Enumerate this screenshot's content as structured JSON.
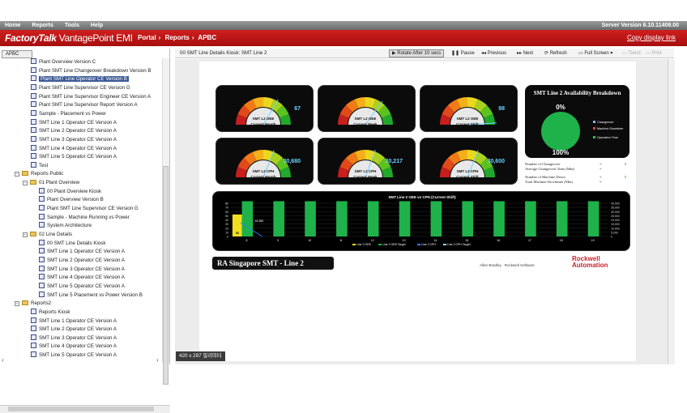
{
  "menu": {
    "items": [
      "Home",
      "Reports",
      "Tools",
      "Help"
    ],
    "server_version": "Server Version 6.10.11409.00"
  },
  "header": {
    "brand_bold": "FactoryTalk",
    "brand_rest": " VantagePoint EMI",
    "breadcrumb": [
      "Portal",
      "Reports",
      "APBC"
    ],
    "copy_link": "Copy display link"
  },
  "left": {
    "tab_label": "APBC",
    "tree": [
      {
        "label": "Plant Overview Version C",
        "kind": "doc",
        "indent": 3
      },
      {
        "label": "Plant SMT Line Changeover Breakdown Version B",
        "kind": "doc",
        "indent": 3
      },
      {
        "label": "Plant SMT Line Operator CE Version B",
        "kind": "doc",
        "indent": 3,
        "selected": true
      },
      {
        "label": "Plant SMT Line Supervisor CE Version G",
        "kind": "doc",
        "indent": 3
      },
      {
        "label": "Plant SMT Line Supervisor Engineer CE Version A",
        "kind": "doc",
        "indent": 3
      },
      {
        "label": "Plant SMT Line Supervisor Report Version A",
        "kind": "doc",
        "indent": 3
      },
      {
        "label": "Sample - Placement vs Power",
        "kind": "doc",
        "indent": 3
      },
      {
        "label": "SMT Line 1 Operator CE Version A",
        "kind": "doc",
        "indent": 3
      },
      {
        "label": "SMT Line 2 Operator CE Version A",
        "kind": "doc",
        "indent": 3
      },
      {
        "label": "SMT Line 3 Operator CE Version A",
        "kind": "doc",
        "indent": 3
      },
      {
        "label": "SMT Line 4 Operator CE Version A",
        "kind": "doc",
        "indent": 3
      },
      {
        "label": "SMT Line 5 Operator CE Version A",
        "kind": "doc",
        "indent": 3
      },
      {
        "label": "Test",
        "kind": "doc",
        "indent": 3
      },
      {
        "label": "Reports Public",
        "kind": "folder",
        "indent": 1
      },
      {
        "label": "01 Plant Overview",
        "kind": "folder",
        "indent": 2
      },
      {
        "label": "00 Plant Overview Kiosk",
        "kind": "doc",
        "indent": 4
      },
      {
        "label": "Plant Overview Version B",
        "kind": "doc",
        "indent": 4
      },
      {
        "label": "Plant SMT Line Supervisor CE Version G",
        "kind": "doc",
        "indent": 4
      },
      {
        "label": "Sample - Machine Running vs Power",
        "kind": "doc",
        "indent": 4
      },
      {
        "label": "System Architecture",
        "kind": "doc",
        "indent": 4
      },
      {
        "label": "02 Line Details",
        "kind": "folder",
        "indent": 2
      },
      {
        "label": "00 SMT Line Details Kiosk",
        "kind": "doc",
        "indent": 4
      },
      {
        "label": "SMT Line 1 Operator CE Version A",
        "kind": "doc",
        "indent": 4
      },
      {
        "label": "SMT Line 2 Operator CE Version A",
        "kind": "doc",
        "indent": 4
      },
      {
        "label": "SMT Line 3 Operator CE Version A",
        "kind": "doc",
        "indent": 4
      },
      {
        "label": "SMT Line 4 Operator CE Version A",
        "kind": "doc",
        "indent": 4
      },
      {
        "label": "SMT Line 5 Operator CE Version A",
        "kind": "doc",
        "indent": 4
      },
      {
        "label": "SMT Line 5 Placement vs Power Version B",
        "kind": "doc",
        "indent": 4
      },
      {
        "label": "Reports2",
        "kind": "folder",
        "indent": 1
      },
      {
        "label": "Reports Kiosk",
        "kind": "doc",
        "indent": 3
      },
      {
        "label": "SMT Line 1 Operator CE Version A",
        "kind": "doc",
        "indent": 3
      },
      {
        "label": "SMT Line 2 Operator CE Version A",
        "kind": "doc",
        "indent": 3
      },
      {
        "label": "SMT Line 3 Operator CE Version A",
        "kind": "doc",
        "indent": 3
      },
      {
        "label": "SMT Line 4 Operator CE Version A",
        "kind": "doc",
        "indent": 3
      },
      {
        "label": "SMT Line 5 Operator CE Version A",
        "kind": "doc",
        "indent": 3
      }
    ]
  },
  "toolbar": {
    "title": "00 SMT Line Details Kiosk: SMT Line 2",
    "buttons": [
      {
        "name": "rotate-button",
        "label": "Rotate After 10 secs",
        "active": true
      },
      {
        "name": "pause-button",
        "label": "Pause"
      },
      {
        "name": "previous-button",
        "label": "Previous"
      },
      {
        "name": "next-button",
        "label": "Next"
      },
      {
        "name": "refresh-button",
        "label": "Refresh"
      },
      {
        "name": "full-screen-button",
        "label": "Full Screen"
      },
      {
        "name": "trend-button",
        "label": "Trend",
        "disabled": true
      },
      {
        "name": "print-button",
        "label": "Print",
        "disabled": true
      }
    ]
  },
  "dashboard": {
    "gauges": [
      {
        "label1": "SMT L2 OEE",
        "label2": "Current Month",
        "value": "67",
        "pct": 0.67
      },
      {
        "label1": "SMT L2 OEE",
        "label2": "Current Week",
        "value": "",
        "pct": 0.7
      },
      {
        "label1": "SMT L2 OEE",
        "label2": "Current Shift",
        "value": "98",
        "pct": 0.98
      },
      {
        "label1": "SMT L2 CPH",
        "label2": "Current Month",
        "value": "30,680",
        "pct": 0.62
      },
      {
        "label1": "SMT L2 CPH",
        "label2": "Current Week",
        "value": "30,217",
        "pct": 0.61
      },
      {
        "label1": "SMT L2 CPH",
        "label2": "Current Shift",
        "value": "30,600",
        "pct": 0.62
      }
    ],
    "availability": {
      "title": "SMT Line 2 Availability Breakdown",
      "top_pct": "0%",
      "bottom_pct": "100%",
      "legend": [
        "Changeover",
        "Machine Downtime",
        "Operation Time"
      ],
      "legend_colors": [
        "#8ab4ff",
        "#ff3a3a",
        "#2ec24a"
      ]
    },
    "stats": [
      {
        "label": "Number of Changeover",
        "value": "0"
      },
      {
        "label": "Average Changeover Time (Min)",
        "value": ""
      },
      {
        "label": "Number of Machine Down",
        "value": "0"
      },
      {
        "label": "Total Machine Downtime (Min)",
        "value": ""
      }
    ],
    "caption": "RA Singapore SMT - Line 2",
    "ab_text": "Allen-Bradley · Rockwell Software",
    "rockwell1": "Rockwell",
    "rockwell2": "Automation"
  },
  "chart_data": {
    "type": "bar",
    "title": "SMT Line 2 OEE vs CPH (Current Shift)",
    "categories": [
      "8",
      "9",
      "10",
      "11",
      "12",
      "13",
      "14",
      "15",
      "16",
      "17",
      "18",
      "19"
    ],
    "series": [
      {
        "name": "Line 2 OEE",
        "values": [
          53,
          null,
          null,
          null,
          null,
          null,
          null,
          null,
          null,
          null,
          null,
          null
        ],
        "color": "#f0e020"
      },
      {
        "name": "Line 2 OEE Target",
        "values": [
          85,
          85,
          85,
          85,
          85,
          85,
          85,
          85,
          85,
          85,
          85,
          85
        ],
        "color": "#1fb24a"
      },
      {
        "name": "Line 2 CPH",
        "values": [
          16360,
          null,
          null,
          null,
          null,
          null,
          null,
          null,
          null,
          null,
          null,
          null
        ],
        "color": "#2a7dff"
      },
      {
        "name": "Line 2 CPH Target",
        "values": [
          null,
          null,
          null,
          null,
          null,
          null,
          null,
          null,
          null,
          null,
          null,
          null
        ],
        "color": "#9fd0ff"
      }
    ],
    "data_labels": [
      "53",
      "16,360"
    ],
    "y_left": [
      0,
      80
    ],
    "y_left_ticks": [
      "0",
      "10",
      "20",
      "30",
      "40",
      "50",
      "60",
      "70",
      "80"
    ],
    "y_right_ticks": [
      "0",
      "5,000",
      "10,000",
      "15,000",
      "20,000",
      "25,000",
      "30,000",
      "35,000",
      "40,000"
    ],
    "legend_position": "bottom"
  },
  "status": {
    "dimensions": "420 x 297 밀리미터"
  }
}
